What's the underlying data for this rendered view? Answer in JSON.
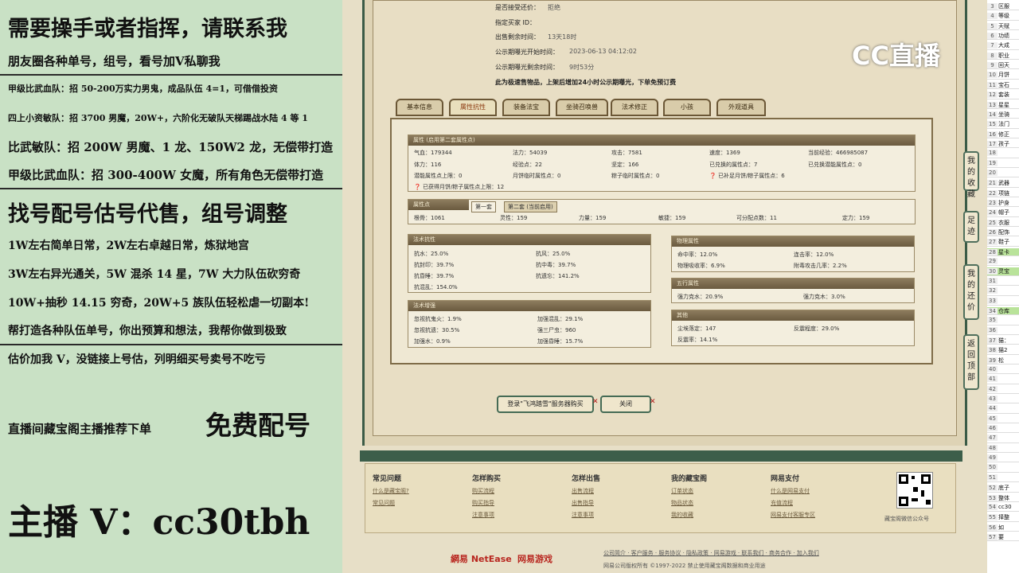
{
  "left": {
    "lines": [
      "需要操手或者指挥，请联系我",
      "朋友圈各种单号，组号，看号加V私聊我",
      "甲级比武血队：招 50-200万实力男鬼，成品队伍 4=1，可借借投资",
      "四上小资敏队：招 3700 男魔，20W+，六阶化无破队天梯踢战水陆 4 等 1",
      "比武敏队：招 200W 男魔、1 龙、150W2 龙，无偿带打造",
      "甲级比武血队：招 300-400W 女魔，所有角色无偿带打造",
      "找号配号估号代售，组号调整",
      "1W左右简单日常，2W左右卓越日常，炼狱地宫",
      "3W左右异光通关，5W 混杀 14 星，7W 大力队伍砍穷奇",
      "10W+抽秒 14.15 穷奇，20W+5 族队伍轻松虐一切副本!",
      "帮打造各种队伍单号，你出预算和想法，我帮你做到极致",
      "估价加我 V，没链接上号估，列明细买号卖号不吃亏",
      "直播间藏宝阁主播推荐下单",
      "免费配号",
      "主播 V：cc30tbh"
    ]
  },
  "info": [
    {
      "k": "是否接受还价：",
      "v": "拒绝"
    },
    {
      "k": "指定买家 ID：",
      "v": ""
    },
    {
      "k": "出售剩余时间：",
      "v": "13天18时"
    },
    {
      "k": "公示期曝光开始时间：",
      "v": "2023-06-13 04:12:02"
    },
    {
      "k": "公示期曝光剩余时间：",
      "v": "9时53分"
    },
    {
      "k": "此为极速售物品，上架后增加24小时公示期曝光，下单免预订费",
      "v": ""
    }
  ],
  "tabs": [
    "基本信息",
    "属性抗性",
    "装备法宝",
    "坐骑召唤兽",
    "法术修正",
    "小孩",
    "外观道具"
  ],
  "attr": {
    "title": "属性 (启用第二套属性点)",
    "rows": [
      [
        "气血：179344",
        "法力：54039",
        "攻击：7581",
        "速度：1369",
        "当前经验：466985087"
      ],
      [
        "体力：116",
        "经验点：22",
        "坚定：166",
        "已兑换的属性点：7",
        "已兑换潜能属性点：0"
      ],
      [
        "潜能属性点上限：0",
        "月饼临时属性点：0",
        "粽子临时属性点：0",
        "已补足月饼/粽子属性点：6",
        ""
      ]
    ],
    "note": "已获得月饼/粽子属性点上限：12"
  },
  "points": {
    "title": "属性点",
    "sub1": "第一套",
    "sub2": "第二套 (当前启用)",
    "cells": [
      "根骨：1061",
      "灵性：159",
      "力量：159",
      "敏捷：159",
      "可分配点数：11",
      "定力：159"
    ]
  },
  "resist": {
    "title": "法术抗性",
    "cells": [
      "抗水：25.0%",
      "抗风：25.0%",
      "抗封印：39.7%",
      "抗中毒：39.7%",
      "抗昏睡：39.7%",
      "抗遗忘：141.2%",
      "抗混乱：154.0%"
    ]
  },
  "boost": {
    "title": "法术增强",
    "cells": [
      "忽视抗鬼火：1.9%",
      "加强混乱：29.1%",
      "忽视抗遗：30.5%",
      "强三尸虫：960",
      "加强水：0.9%",
      "加强昏睡：15.7%"
    ]
  },
  "phys": {
    "title": "物理属性",
    "cells": [
      "命中率：12.0%",
      "连击率：12.0%",
      "物理吸收率：6.9%",
      "附毒攻击几率：2.2%"
    ]
  },
  "five": {
    "title": "五行属性",
    "cells": [
      "强力克水：20.9%",
      "强力克木：3.0%"
    ]
  },
  "other": {
    "title": "其他",
    "cells": [
      "尘埃落定：147",
      "反震程度：29.0%",
      "反震率：14.1%"
    ]
  },
  "buttons": {
    "login": "登录\"飞鸿踏雪\"服务器购买",
    "close": "关闭"
  },
  "footer": {
    "cols": [
      {
        "t": "常见问题",
        "links": [
          "什么是藏宝阁?",
          "常见问题"
        ]
      },
      {
        "t": "怎样购买",
        "links": [
          "购买流程",
          "购买指导",
          "注意事项"
        ]
      },
      {
        "t": "怎样出售",
        "links": [
          "出售流程",
          "出售指导",
          "注意事项"
        ]
      },
      {
        "t": "我的藏宝阁",
        "links": [
          "订单状态",
          "物品状态",
          "我的收藏"
        ]
      },
      {
        "t": "网易支付",
        "links": [
          "什么是网易支付",
          "充值流程",
          "网易支付客服专区"
        ]
      }
    ],
    "qr_label": "藏宝阁微信公众号",
    "links_line": "公司简介 · 客户服务 · 服务协议 · 隐私政策 · 网易游戏 · 联系我们 · 商务合作 · 加入我们",
    "copyright": "网易公司版权所有 ©1997-2022 禁止使用藏宝阁数据和商业用途",
    "netease": "網易 NetEase",
    "games": "网易游戏"
  },
  "cc_logo": "CC直播",
  "side": [
    "我的收藏",
    "足迹",
    "我的还价",
    "返回顶部"
  ],
  "sheet": [
    [
      "3",
      "区服"
    ],
    [
      "4",
      "等级"
    ],
    [
      "5",
      "天赋"
    ],
    [
      "6",
      "功绩"
    ],
    [
      "7",
      "大成"
    ],
    [
      "8",
      "职业"
    ],
    [
      "9",
      "回天"
    ],
    [
      "10",
      "月饼"
    ],
    [
      "11",
      "宝石"
    ],
    [
      "12",
      "套装"
    ],
    [
      "13",
      "星星"
    ],
    [
      "14",
      "坐骑"
    ],
    [
      "15",
      "法门"
    ],
    [
      "16",
      "修正"
    ],
    [
      "17",
      "孩子"
    ],
    [
      "18",
      ""
    ],
    [
      "19",
      ""
    ],
    [
      "20",
      ""
    ],
    [
      "21",
      "武器"
    ],
    [
      "22",
      "项链"
    ],
    [
      "23",
      "护身"
    ],
    [
      "24",
      "帽子"
    ],
    [
      "25",
      "衣服"
    ],
    [
      "26",
      "配饰"
    ],
    [
      "27",
      "鞋子"
    ],
    [
      "28",
      "星卡"
    ],
    [
      "29",
      ""
    ],
    [
      "30",
      "灵宝"
    ],
    [
      "31",
      ""
    ],
    [
      "32",
      ""
    ],
    [
      "33",
      ""
    ],
    [
      "34",
      "仓库"
    ],
    [
      "35",
      ""
    ],
    [
      "36",
      ""
    ],
    [
      "37",
      "猫："
    ],
    [
      "38",
      "猫2"
    ],
    [
      "39",
      "松"
    ],
    [
      "40",
      ""
    ],
    [
      "41",
      ""
    ],
    [
      "42",
      ""
    ],
    [
      "43",
      ""
    ],
    [
      "44",
      ""
    ],
    [
      "45",
      ""
    ],
    [
      "46",
      ""
    ],
    [
      "47",
      ""
    ],
    [
      "48",
      ""
    ],
    [
      "49",
      ""
    ],
    [
      "50",
      ""
    ],
    [
      "51",
      ""
    ],
    [
      "52",
      "底子"
    ],
    [
      "53",
      "整体"
    ],
    [
      "54",
      "cc30"
    ],
    [
      "55",
      "择整"
    ],
    [
      "56",
      "如"
    ],
    [
      "57",
      "要"
    ]
  ]
}
